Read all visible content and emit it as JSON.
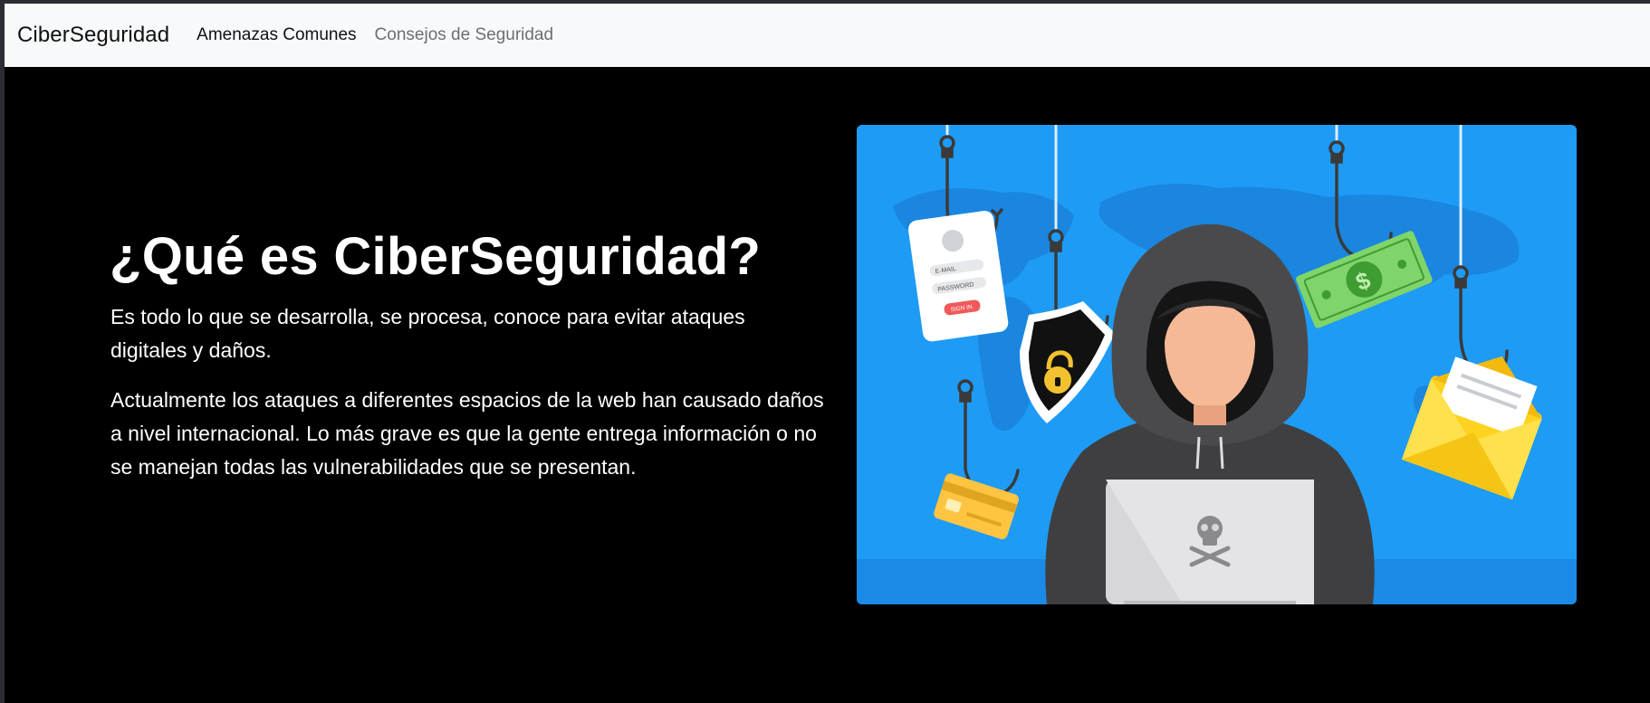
{
  "navbar": {
    "brand": "CiberSeguridad",
    "links": [
      {
        "label": "Amenazas Comunes",
        "active": true
      },
      {
        "label": "Consejos de Seguridad",
        "active": false
      }
    ]
  },
  "hero": {
    "title": "¿Qué es CiberSeguridad?",
    "paragraphs": [
      "Es todo lo que se desarrolla, se procesa, conoce para evitar ataques digitales y daños.",
      "Actualmente los ataques a diferentes espacios de la web han causado daños a nivel internacional. Lo más grave es que la gente entrega información o no se manejan todas las vulnerabilidades que se presentan."
    ],
    "illustration": {
      "form_fields": [
        "E-MAIL",
        "PASSWORD"
      ],
      "form_button": "SIGN IN",
      "dollar_sign": "$"
    }
  },
  "colors": {
    "navbar_bg": "#f8f9fa",
    "hero_bg": "#000000",
    "illustration_bg": "#1e9bf5",
    "map": "#1a86df",
    "hoodie": "#4a4a4c",
    "laptop": "#d7d7d9",
    "envelope": "#ffd21f",
    "money": "#7fd46a",
    "card": "#ffc542"
  }
}
